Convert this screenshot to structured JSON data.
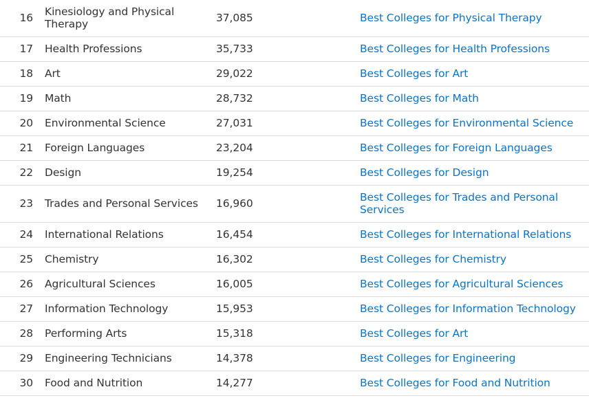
{
  "rows": [
    {
      "rank": "16",
      "major": "Kinesiology and Physical Therapy",
      "count": "37,085",
      "link": "Best Colleges for Physical Therapy"
    },
    {
      "rank": "17",
      "major": "Health Professions",
      "count": "35,733",
      "link": "Best Colleges for Health Professions"
    },
    {
      "rank": "18",
      "major": "Art",
      "count": "29,022",
      "link": "Best Colleges for Art"
    },
    {
      "rank": "19",
      "major": "Math",
      "count": "28,732",
      "link": "Best Colleges for Math"
    },
    {
      "rank": "20",
      "major": "Environmental Science",
      "count": "27,031",
      "link": "Best Colleges for Environmental Science"
    },
    {
      "rank": "21",
      "major": "Foreign Languages",
      "count": "23,204",
      "link": "Best Colleges for Foreign Languages"
    },
    {
      "rank": "22",
      "major": "Design",
      "count": "19,254",
      "link": "Best Colleges for Design"
    },
    {
      "rank": "23",
      "major": "Trades and Personal Services",
      "count": "16,960",
      "link": "Best Colleges for Trades and Personal Services"
    },
    {
      "rank": "24",
      "major": "International Relations",
      "count": "16,454",
      "link": "Best Colleges for International Relations"
    },
    {
      "rank": "25",
      "major": "Chemistry",
      "count": "16,302",
      "link": "Best Colleges for Chemistry"
    },
    {
      "rank": "26",
      "major": "Agricultural Sciences",
      "count": "16,005",
      "link": "Best Colleges for Agricultural Sciences"
    },
    {
      "rank": "27",
      "major": "Information Technology",
      "count": "15,953",
      "link": "Best Colleges for Information Technology"
    },
    {
      "rank": "28",
      "major": "Performing Arts",
      "count": "15,318",
      "link": "Best Colleges for Art"
    },
    {
      "rank": "29",
      "major": "Engineering Technicians",
      "count": "14,378",
      "link": "Best Colleges for Engineering"
    },
    {
      "rank": "30",
      "major": "Food and Nutrition",
      "count": "14,277",
      "link": "Best Colleges for Food and Nutrition"
    }
  ],
  "colors": {
    "link": "#0a74c9",
    "text": "#333333",
    "divider": "#dcdcdc"
  }
}
